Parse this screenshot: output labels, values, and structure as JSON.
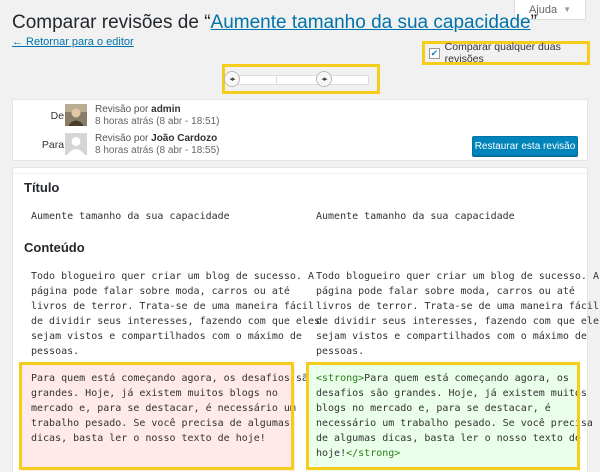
{
  "header": {
    "title_prefix": "Comparar revisões de “",
    "title_link": "Aumente tamanho da sua capacidade",
    "title_suffix": "”",
    "return_link": "← Retornar para o editor",
    "help_label": "Ajuda"
  },
  "compare_any": {
    "label": "Comparar qualquer duas revisões",
    "checked": true
  },
  "slider": {
    "handle_left": "◂▸",
    "handle_right": "◂▸"
  },
  "meta": {
    "from": {
      "label": "De:",
      "author_prefix": "Revisão por",
      "author": "admin",
      "time": "8 horas atrás (8 abr - 18:51)"
    },
    "to": {
      "label": "Para:",
      "author_prefix": "Revisão por",
      "author": "João Cardozo",
      "time": "8 horas atrás (8 abr - 18:55)"
    },
    "restore_label": "Restaurar esta revisão"
  },
  "diff": {
    "title_section": "Título",
    "title_left": "Aumente tamanho da sua capacidade",
    "title_right": "Aumente tamanho da sua capacidade",
    "content_section": "Conteúdo",
    "content_left": "Todo blogueiro quer criar um blog de sucesso. A\npágina pode falar sobre moda, carros ou até\nlivros de terror. Trata-se de uma maneira fácil\nde dividir seus interesses, fazendo com que eles\nsejam vistos e compartilhados com o máximo de\npessoas.",
    "content_right": "Todo blogueiro quer criar um blog de sucesso. A\npágina pode falar sobre moda, carros ou até\nlivros de terror. Trata-se de uma maneira fácil\nde dividir seus interesses, fazendo com que eles\nsejam vistos e compartilhados com o máximo de\npessoas.",
    "removed": "Para quem está começando agora, os desafios são\ngrandes. Hoje, já existem muitos blogs no\nmercado e, para se destacar, é necessário um\ntrabalho pesado. Se você precisa de algumas\ndicas, basta ler o nosso texto de hoje!",
    "added_open_tag": "<strong>",
    "added_line1": "Para quem está começando agora, os",
    "added_rest": "desafios são grandes. Hoje, já existem muitos\nblogs no mercado e, para se destacar, é\nnecessário um trabalho pesado. Se você precisa\nde algumas dicas, basta ler o nosso texto de\n",
    "added_last": "hoje!",
    "added_close_tag": "</strong>"
  },
  "colors": {
    "accent": "#0073aa",
    "highlight": "#f7cd1c",
    "removed_bg": "#ffe9e9",
    "added_bg": "#e9ffe9",
    "tag": "#2c7d1a"
  }
}
